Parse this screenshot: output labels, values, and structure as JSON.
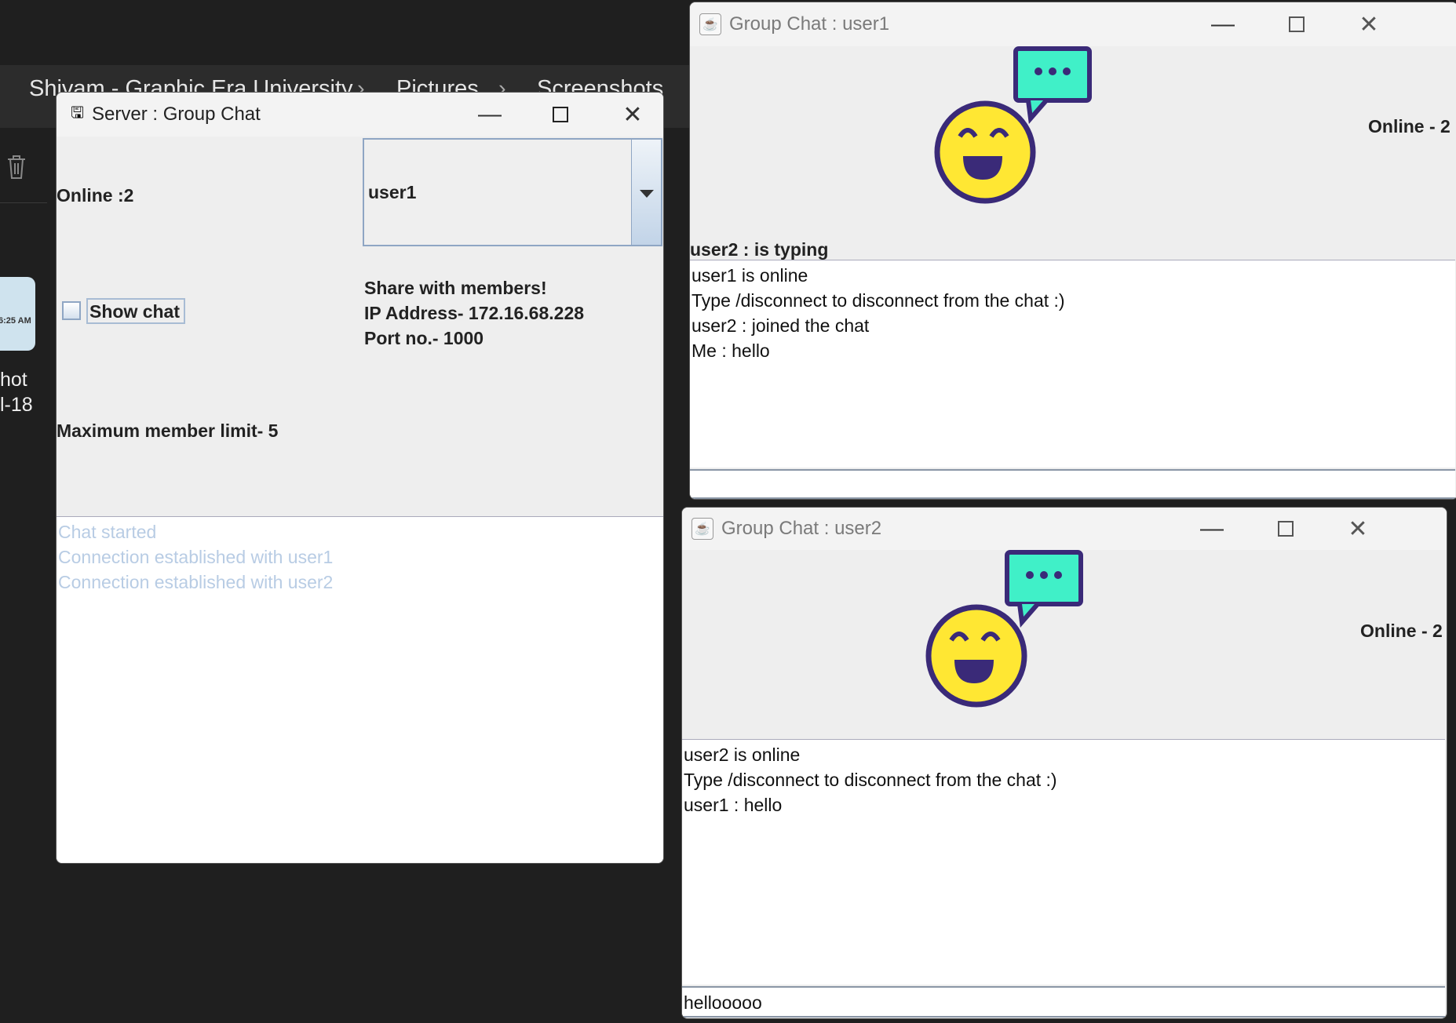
{
  "explorer": {
    "breadcrumb": [
      "Shivam - Graphic Era University",
      "Pictures",
      "Screenshots"
    ],
    "thumb_time": "6:25 AM",
    "file_label_lines": [
      "hot",
      "l-18"
    ]
  },
  "server": {
    "title": "Server : Group Chat",
    "online": "Online :2",
    "selected_user": "user1",
    "show_chat": "Show chat",
    "show_chat_checked": false,
    "share_lines": [
      "Share with members!",
      "IP Address- 172.16.68.228",
      "Port no.- 1000"
    ],
    "max_limit": "Maximum member limit- 5",
    "log": [
      "Chat started",
      "Connection established with user1",
      "Connection established with user2"
    ],
    "log_color": "#b8cce4"
  },
  "client1": {
    "title": "Group Chat : user1",
    "online": "Online - 2",
    "typing": "user2  :  is typing",
    "messages": [
      "user1 is online",
      "Type /disconnect to disconnect from the chat :)",
      "user2  :  joined the chat",
      "Me : hello"
    ],
    "input": ""
  },
  "client2": {
    "title": "Group Chat : user2",
    "online": "Online - 2",
    "messages": [
      "user2  is online",
      "Type /disconnect to disconnect from the chat :)",
      "user1 : hello"
    ],
    "input": "hellooooo"
  },
  "colors": {
    "smiley": "#ffe733",
    "outline": "#3a2a78",
    "bubble": "#40f0c8"
  }
}
